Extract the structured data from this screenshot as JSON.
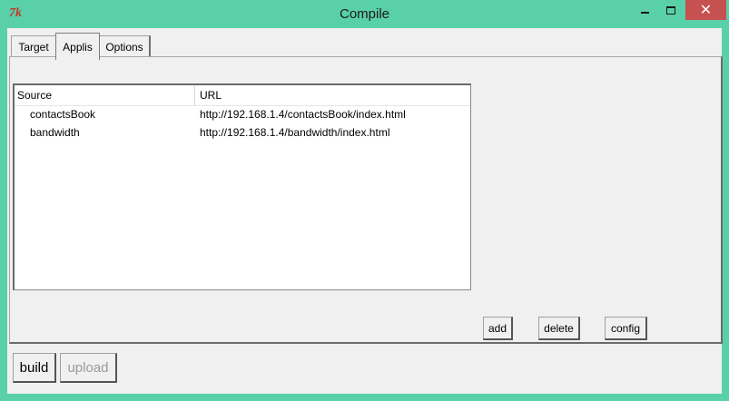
{
  "window": {
    "title": "Compile",
    "logo_text": "7k",
    "close_glyph": "✕"
  },
  "tabs": [
    {
      "label": "Target",
      "active": false
    },
    {
      "label": "Applis",
      "active": true
    },
    {
      "label": "Options",
      "active": false
    }
  ],
  "tree": {
    "columns": [
      "Source",
      "URL"
    ],
    "rows": [
      {
        "source": "contactsBook",
        "url": "http://192.168.1.4/contactsBook/index.html"
      },
      {
        "source": "bandwidth",
        "url": "http://192.168.1.4/bandwidth/index.html"
      }
    ]
  },
  "actions": {
    "add": "add",
    "delete": "delete",
    "config": "config"
  },
  "footer": {
    "build": "build",
    "upload": "upload"
  }
}
